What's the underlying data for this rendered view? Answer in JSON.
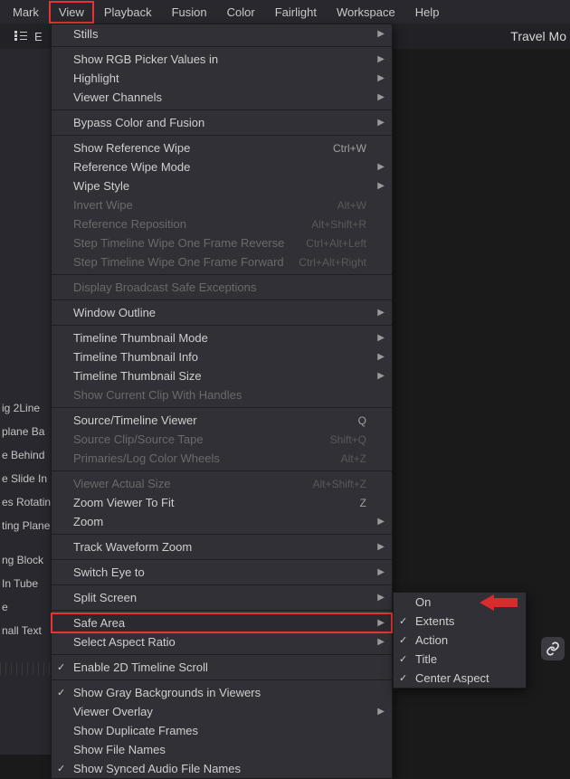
{
  "menubar": [
    "Mark",
    "View",
    "Playback",
    "Fusion",
    "Color",
    "Fairlight",
    "Workspace",
    "Help"
  ],
  "active_menu_index": 1,
  "toolbar": {
    "edit_fragment": "E"
  },
  "title": "Travel Mo",
  "left_fragments": [
    "",
    "",
    "",
    "",
    "",
    "",
    "",
    "ig 2Line",
    "plane Ba",
    "e Behind",
    "e Slide In",
    "es Rotatin",
    "ting Plane",
    "",
    "ng Block",
    "In Tube",
    "e",
    "nall Text",
    ""
  ],
  "view_menu": [
    {
      "type": "item",
      "label": "Stills",
      "submenu": true
    },
    {
      "type": "sep"
    },
    {
      "type": "item",
      "label": "Show RGB Picker Values in",
      "submenu": true
    },
    {
      "type": "item",
      "label": "Highlight",
      "submenu": true
    },
    {
      "type": "item",
      "label": "Viewer Channels",
      "submenu": true
    },
    {
      "type": "sep"
    },
    {
      "type": "item",
      "label": "Bypass Color and Fusion",
      "submenu": true
    },
    {
      "type": "sep"
    },
    {
      "type": "item",
      "label": "Show Reference Wipe",
      "shortcut": "Ctrl+W"
    },
    {
      "type": "item",
      "label": "Reference Wipe Mode",
      "submenu": true
    },
    {
      "type": "item",
      "label": "Wipe Style",
      "submenu": true
    },
    {
      "type": "item",
      "label": "Invert Wipe",
      "shortcut": "Alt+W",
      "disabled": true
    },
    {
      "type": "item",
      "label": "Reference Reposition",
      "shortcut": "Alt+Shift+R",
      "disabled": true
    },
    {
      "type": "item",
      "label": "Step Timeline Wipe One Frame Reverse",
      "shortcut": "Ctrl+Alt+Left",
      "disabled": true
    },
    {
      "type": "item",
      "label": "Step Timeline Wipe One Frame Forward",
      "shortcut": "Ctrl+Alt+Right",
      "disabled": true
    },
    {
      "type": "sep"
    },
    {
      "type": "item",
      "label": "Display Broadcast Safe Exceptions",
      "disabled": true
    },
    {
      "type": "sep"
    },
    {
      "type": "item",
      "label": "Window Outline",
      "submenu": true
    },
    {
      "type": "sep"
    },
    {
      "type": "item",
      "label": "Timeline Thumbnail Mode",
      "submenu": true
    },
    {
      "type": "item",
      "label": "Timeline Thumbnail Info",
      "submenu": true
    },
    {
      "type": "item",
      "label": "Timeline Thumbnail Size",
      "submenu": true
    },
    {
      "type": "item",
      "label": "Show Current Clip With Handles",
      "disabled": true
    },
    {
      "type": "sep"
    },
    {
      "type": "item",
      "label": "Source/Timeline Viewer",
      "shortcut": "Q"
    },
    {
      "type": "item",
      "label": "Source Clip/Source Tape",
      "shortcut": "Shift+Q",
      "disabled": true
    },
    {
      "type": "item",
      "label": "Primaries/Log Color Wheels",
      "shortcut": "Alt+Z",
      "disabled": true
    },
    {
      "type": "sep"
    },
    {
      "type": "item",
      "label": "Viewer Actual Size",
      "shortcut": "Alt+Shift+Z",
      "disabled": true
    },
    {
      "type": "item",
      "label": "Zoom Viewer To Fit",
      "shortcut": "Z"
    },
    {
      "type": "item",
      "label": "Zoom",
      "submenu": true
    },
    {
      "type": "sep"
    },
    {
      "type": "item",
      "label": "Track Waveform Zoom",
      "submenu": true
    },
    {
      "type": "sep"
    },
    {
      "type": "item",
      "label": "Switch Eye to",
      "submenu": true
    },
    {
      "type": "sep"
    },
    {
      "type": "item",
      "label": "Split Screen",
      "submenu": true
    },
    {
      "type": "sep"
    },
    {
      "type": "item",
      "label": "Safe Area",
      "submenu": true,
      "highlighted": true
    },
    {
      "type": "item",
      "label": "Select Aspect Ratio",
      "submenu": true
    },
    {
      "type": "sep"
    },
    {
      "type": "item",
      "label": "Enable 2D Timeline Scroll",
      "checked": true
    },
    {
      "type": "sep"
    },
    {
      "type": "item",
      "label": "Show Gray Backgrounds in Viewers",
      "checked": true
    },
    {
      "type": "item",
      "label": "Viewer Overlay",
      "submenu": true
    },
    {
      "type": "item",
      "label": "Show Duplicate Frames"
    },
    {
      "type": "item",
      "label": "Show File Names"
    },
    {
      "type": "item",
      "label": "Show Synced Audio File Names",
      "checked": true
    }
  ],
  "safe_area_submenu": [
    {
      "label": "On"
    },
    {
      "label": "Extents",
      "checked": true
    },
    {
      "label": "Action",
      "checked": true
    },
    {
      "label": "Title",
      "checked": true
    },
    {
      "label": "Center Aspect",
      "checked": true
    }
  ]
}
